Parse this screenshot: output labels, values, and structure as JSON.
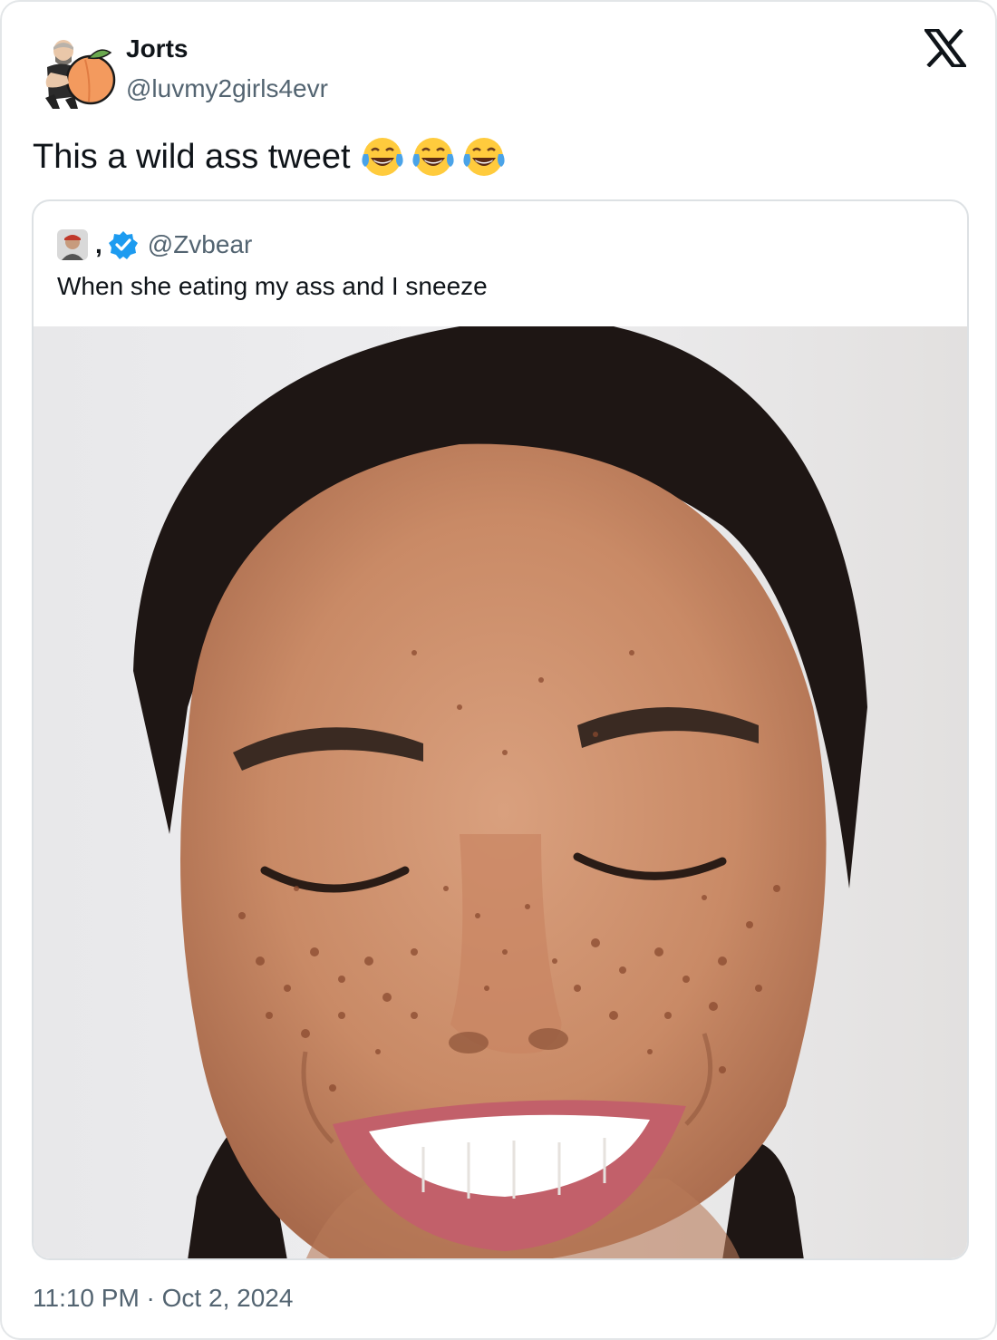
{
  "author": {
    "name": "Jorts",
    "handle": "@luvmy2girls4evr",
    "avatar_icon": "bitmoji-peach-avatar"
  },
  "tweet": {
    "text": "This a wild ass tweet",
    "emojis": [
      "face-with-tears-of-joy-icon",
      "face-with-tears-of-joy-icon",
      "face-with-tears-of-joy-icon"
    ]
  },
  "quoted": {
    "comma": ",",
    "handle": "@Zvbear",
    "verified": true,
    "text": "When she eating my ass and I sneeze",
    "image_alt": "Close-up of a smiling woman with freckles and eyes closed"
  },
  "timestamp": "11:10 PM · Oct 2, 2024",
  "colors": {
    "text_primary": "#0f1419",
    "text_secondary": "#536471",
    "verified_blue": "#1d9bf0",
    "border": "#dde1e4"
  }
}
